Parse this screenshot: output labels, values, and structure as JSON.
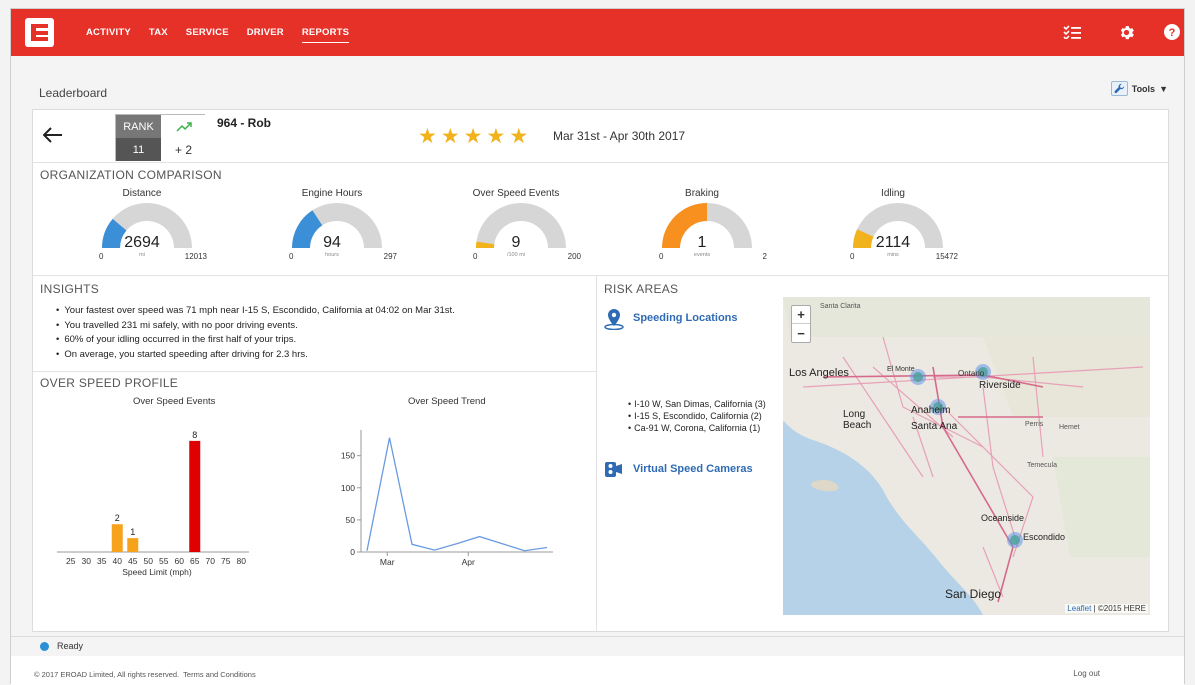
{
  "nav": {
    "items": [
      "ACTIVITY",
      "TAX",
      "SERVICE",
      "DRIVER",
      "REPORTS"
    ],
    "active": "REPORTS"
  },
  "header_icons": [
    "checklist-icon",
    "gear-icon",
    "help-icon"
  ],
  "page": {
    "title": "Leaderboard",
    "tools_label": "Tools"
  },
  "driver": {
    "rank_label": "RANK",
    "rank": "11",
    "rank_change": "+ 2",
    "name": "964 - Rob",
    "stars": 5,
    "date_range": "Mar 31st - Apr 30th 2017"
  },
  "comparison": {
    "section_title": "ORGANIZATION COMPARISON",
    "gauges": [
      {
        "title": "Distance",
        "value": "2694",
        "unit": "mi",
        "min": "0",
        "max": "12013",
        "fraction": 0.224,
        "color": "#3a8fd6"
      },
      {
        "title": "Engine Hours",
        "value": "94",
        "unit": "hours",
        "min": "0",
        "max": "297",
        "fraction": 0.316,
        "color": "#3a8fd6"
      },
      {
        "title": "Over Speed Events",
        "value": "9",
        "unit": "/100 mi",
        "min": "0",
        "max": "200",
        "fraction": 0.045,
        "color": "#f2b21b"
      },
      {
        "title": "Braking",
        "value": "1",
        "unit": "events",
        "min": "0",
        "max": "2",
        "fraction": 0.5,
        "color": "#f7901e"
      },
      {
        "title": "Idling",
        "value": "2114",
        "unit": "mins",
        "min": "0",
        "max": "15472",
        "fraction": 0.137,
        "color": "#f2b21b"
      }
    ]
  },
  "insights": {
    "section_title": "INSIGHTS",
    "items": [
      "Your fastest over speed was 71 mph near I-15 S, Escondido, California at 04:02 on Mar 31st.",
      "You travelled 231 mi safely, with no poor driving events.",
      "60% of your idling occurred in the first half of your trips.",
      "On average, you started speeding after driving for 2.3 hrs."
    ]
  },
  "over_speed": {
    "section_title": "OVER SPEED PROFILE",
    "events_title": "Over Speed Events",
    "trend_title": "Over Speed Trend",
    "xlabel": "Speed Limit (mph)"
  },
  "chart_data": [
    {
      "type": "bar",
      "title": "Over Speed Events",
      "xlabel": "Speed Limit (mph)",
      "categories": [
        "25",
        "30",
        "35",
        "40",
        "45",
        "50",
        "55",
        "60",
        "65",
        "70",
        "75",
        "80"
      ],
      "values": [
        0,
        0,
        0,
        2,
        1,
        0,
        0,
        0,
        8,
        0,
        0,
        0
      ],
      "colors": [
        "#f2b21b",
        "#f2b21b",
        "#f2b21b",
        "#f7a21b",
        "#f7a21b",
        "#f2b21b",
        "#f2b21b",
        "#f2b21b",
        "#e00000",
        "#e00000",
        "#e00000",
        "#e00000"
      ],
      "ylim": [
        0,
        9
      ]
    },
    {
      "type": "line",
      "title": "Over Speed Trend",
      "x_ticks": [
        "Mar",
        "Apr"
      ],
      "yticks": [
        "0",
        "50",
        "100",
        "150"
      ],
      "values": [
        2,
        178,
        12,
        3,
        13,
        24,
        13,
        2,
        7
      ],
      "ylim": [
        0,
        190
      ]
    }
  ],
  "risk_areas": {
    "section_title": "RISK AREAS",
    "speeding_label": "Speeding Locations",
    "speeding_locations": [
      "I-10 W, San Dimas, California (3)",
      "I-15 S, Escondido, California (2)",
      "Ca-91 W, Corona, California (1)"
    ],
    "cameras_label": "Virtual Speed Cameras"
  },
  "map": {
    "labels": [
      "Los Angeles",
      "Long Beach",
      "Santa Ana",
      "Anaheim",
      "Ontario",
      "Riverside",
      "Temecula",
      "Oceanside",
      "Escondido",
      "San Diego",
      "El Monte",
      "Santa Clarita",
      "Perris",
      "Hemet"
    ],
    "attribution_link": "Leaflet",
    "attribution_text": " | ©2015 HERE",
    "zoom_in": "+",
    "zoom_out": "−"
  },
  "status": {
    "text": "Ready"
  },
  "footer": {
    "copyright": "© 2017 EROAD Limited, All rights reserved.",
    "terms_link": "Terms and Conditions",
    "logout": "Log out"
  }
}
